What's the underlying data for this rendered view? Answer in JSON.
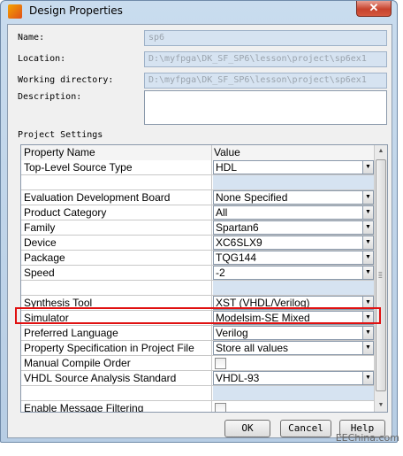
{
  "window": {
    "title": "Design Properties",
    "close_glyph": "✕",
    "app_icon": "ise-app-icon"
  },
  "form": {
    "name_label": "Name:",
    "name_value": "sp6",
    "location_label": "Location:",
    "location_value": "D:\\myfpga\\DK_SF_SP6\\lesson\\project\\sp6ex1",
    "working_dir_label": "Working directory:",
    "working_dir_value": "D:\\myfpga\\DK_SF_SP6\\lesson\\project\\sp6ex1",
    "description_label": "Description:",
    "description_value": ""
  },
  "settings": {
    "section_label": "Project Settings",
    "col_property": "Property Name",
    "col_value": "Value",
    "rows": [
      {
        "kind": "combo",
        "name": "Top-Level Source Type",
        "value": "HDL"
      },
      {
        "kind": "blank"
      },
      {
        "kind": "combo",
        "name": "Evaluation Development Board",
        "value": "None Specified"
      },
      {
        "kind": "combo",
        "name": "Product Category",
        "value": "All"
      },
      {
        "kind": "combo",
        "name": "Family",
        "value": "Spartan6"
      },
      {
        "kind": "combo",
        "name": "Device",
        "value": "XC6SLX9"
      },
      {
        "kind": "combo",
        "name": "Package",
        "value": "TQG144"
      },
      {
        "kind": "combo",
        "name": "Speed",
        "value": "-2"
      },
      {
        "kind": "blank"
      },
      {
        "kind": "combo",
        "name": "Synthesis Tool",
        "value": "XST (VHDL/Verilog)"
      },
      {
        "kind": "combo",
        "name": "Simulator",
        "value": "Modelsim-SE Mixed"
      },
      {
        "kind": "combo",
        "name": "Preferred Language",
        "value": "Verilog"
      },
      {
        "kind": "combo",
        "name": "Property Specification in Project File",
        "value": "Store all values"
      },
      {
        "kind": "check",
        "name": "Manual Compile Order",
        "checked": false
      },
      {
        "kind": "combo",
        "name": "VHDL Source Analysis Standard",
        "value": "VHDL-93"
      },
      {
        "kind": "blank"
      },
      {
        "kind": "check",
        "name": "Enable Message Filtering",
        "checked": false
      }
    ],
    "highlighted_row": "Simulator",
    "highlight_color": "#e01010"
  },
  "buttons": {
    "ok": "OK",
    "cancel": "Cancel",
    "help": "Help"
  },
  "watermark": "EEChina.com"
}
